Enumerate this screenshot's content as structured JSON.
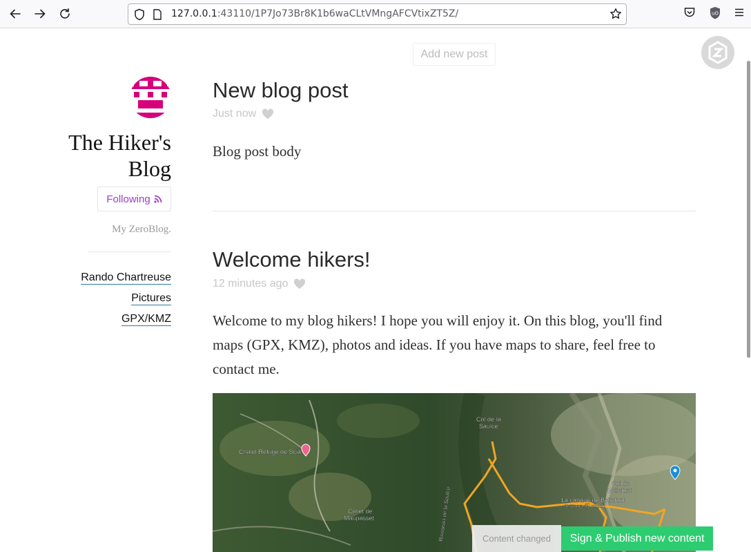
{
  "browser": {
    "url_host": "127.0.0.1",
    "url_rest": ":43110/1P7Jo73Br8K1b6waCLtVMngAFCVtixZT5Z/"
  },
  "toolbar": {
    "add_post_label": "Add new post"
  },
  "sidebar": {
    "blog_title": "The Hiker's Blog",
    "follow_label": "Following",
    "tagline": "My ZeroBlog.",
    "links": [
      {
        "label": "Rando Chartreuse"
      },
      {
        "label": "Pictures"
      },
      {
        "label": "GPX/KMZ"
      }
    ]
  },
  "posts": [
    {
      "title": "New blog post",
      "time": "Just now",
      "body": "Blog post body"
    },
    {
      "title": "Welcome hikers!",
      "time": "12 minutes ago",
      "body": "Welcome to my blog hikers! I hope you will enjoy it. On this blog, you'll find maps (GPX, KMZ), photos and ideas. If you have maps to share, feel free to contact me."
    }
  ],
  "map": {
    "labels": {
      "chalet": "Chalet Refuge de Scia",
      "col_saulce_1": "Col de la",
      "col_saulce_2": "Saulce",
      "col_bellefont_1": "Col de",
      "col_bellefont_2": "Bellefont",
      "cabane": "La cabane de Bellefont",
      "cabane_sub": "Temporarily closed",
      "collet_1": "Collet de",
      "collet_2": "Maupasset",
      "ruisseau": "Ruisseau de la Saulce"
    }
  },
  "notice": {
    "text": "Content changed",
    "publish_label": "Sign & Publish new content"
  },
  "colors": {
    "accent_purple": "#9b3fc0",
    "avatar_magenta": "#d6007a",
    "publish_green": "#2ecc71",
    "trail_orange": "#f0a623"
  }
}
